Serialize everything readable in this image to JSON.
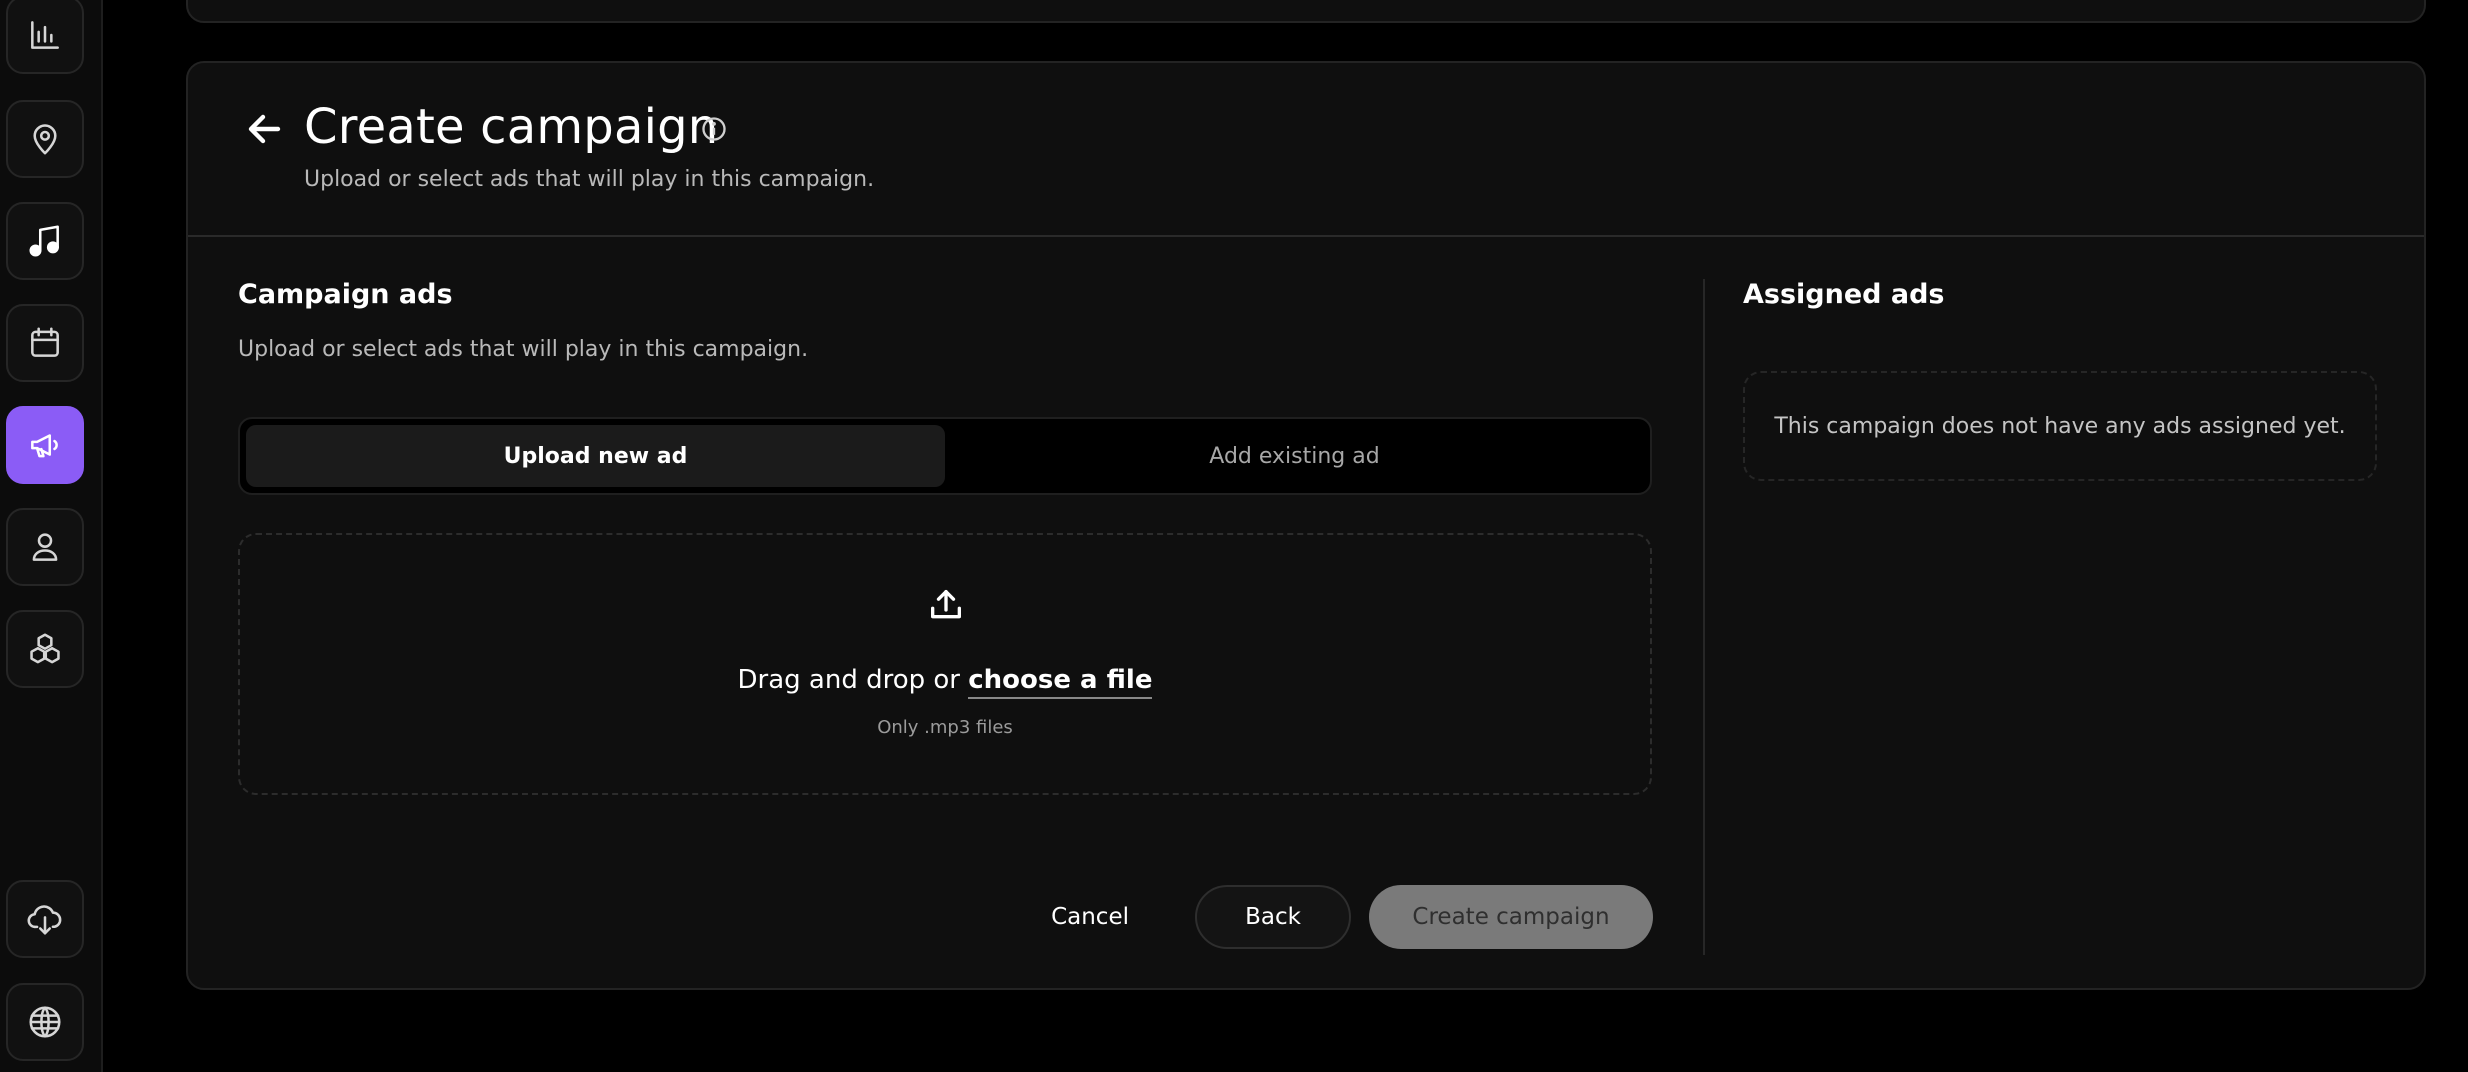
{
  "sidebar": {
    "items": [
      {
        "icon": "bar-chart-icon",
        "active": false
      },
      {
        "icon": "map-pin-icon",
        "active": false
      },
      {
        "icon": "music-note-icon",
        "active": false
      },
      {
        "icon": "calendar-icon",
        "active": false
      },
      {
        "icon": "megaphone-icon",
        "active": true
      },
      {
        "icon": "user-icon",
        "active": false
      },
      {
        "icon": "boxes-icon",
        "active": false
      }
    ],
    "bottom_items": [
      {
        "icon": "cloud-download-icon"
      },
      {
        "icon": "globe-icon"
      }
    ],
    "accent_color": "#8b5cf6"
  },
  "header": {
    "title": "Create campaign",
    "subtitle": "Upload or select ads that will play in this campaign."
  },
  "campaign_ads": {
    "title": "Campaign ads",
    "description": "Upload or select ads that will play in this campaign.",
    "tabs": [
      {
        "label": "Upload new ad",
        "active": true
      },
      {
        "label": "Add existing ad",
        "active": false
      }
    ],
    "dropzone": {
      "text_prefix": "Drag and drop or ",
      "link_label": "choose a file",
      "hint": "Only .mp3 files"
    }
  },
  "actions": {
    "cancel_label": "Cancel",
    "back_label": "Back",
    "create_label": "Create campaign"
  },
  "assigned_ads": {
    "title": "Assigned ads",
    "empty_message": "This campaign does not have any ads assigned yet."
  }
}
